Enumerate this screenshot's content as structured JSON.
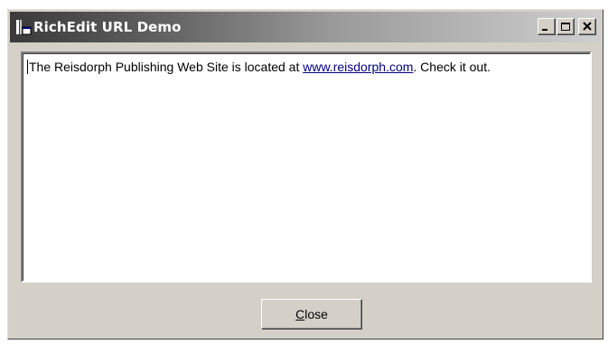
{
  "window": {
    "title": "RichEdit URL Demo",
    "icon": "app-window-icon"
  },
  "caption_buttons": {
    "minimize_icon": "minimize-icon",
    "maximize_icon": "maximize-icon",
    "close_icon": "close-icon"
  },
  "editor": {
    "text_before": "The Reisdorph Publishing Web Site is located at ",
    "link_text": "www.reisdorph.com",
    "text_after": ". Check it out.",
    "link_color": "#000080"
  },
  "footer": {
    "close_button": {
      "accelerator": "C",
      "rest": "lose"
    }
  },
  "colors": {
    "face": "#d4d0c8",
    "titlebar_dark": "#3a3a3a",
    "titlebar_light": "#cfcfcf"
  }
}
